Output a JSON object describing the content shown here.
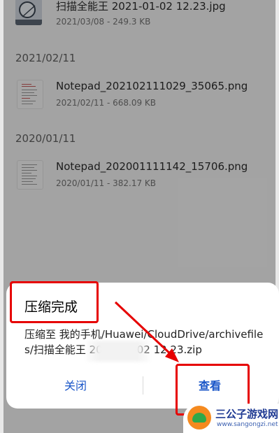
{
  "file_list": {
    "items": [
      {
        "name": "扫描全能王 2021-01-02 12.23.jpg",
        "meta": "2021/03/08 - 249.3 KB",
        "thumb_icon": "photo-thumbnail-icon"
      },
      {
        "name": "Notepad_202102111029_35065.png",
        "meta": "2021/02/11 - 668.09 KB",
        "thumb_icon": "document-thumbnail-icon"
      },
      {
        "name": "Notepad_202001111142_15706.png",
        "meta": "2020/01/11 - 382.17 KB",
        "thumb_icon": "document-thumbnail-icon"
      }
    ],
    "date_headers": [
      "2021/02/11",
      "2020/01/11"
    ]
  },
  "dialog": {
    "title": "压缩完成",
    "message": "压缩至 我的手机/Huawei/CloudDrive/archivefiles/扫描全能王 2021-01-02 12.23.zip",
    "cancel_label": "关闭",
    "view_label": "查看",
    "accent_color": "#1a56c8"
  },
  "annotation": {
    "color": "#e60000"
  },
  "watermark": {
    "title": "三公子游戏网",
    "url": "www.sangongzi.net"
  }
}
